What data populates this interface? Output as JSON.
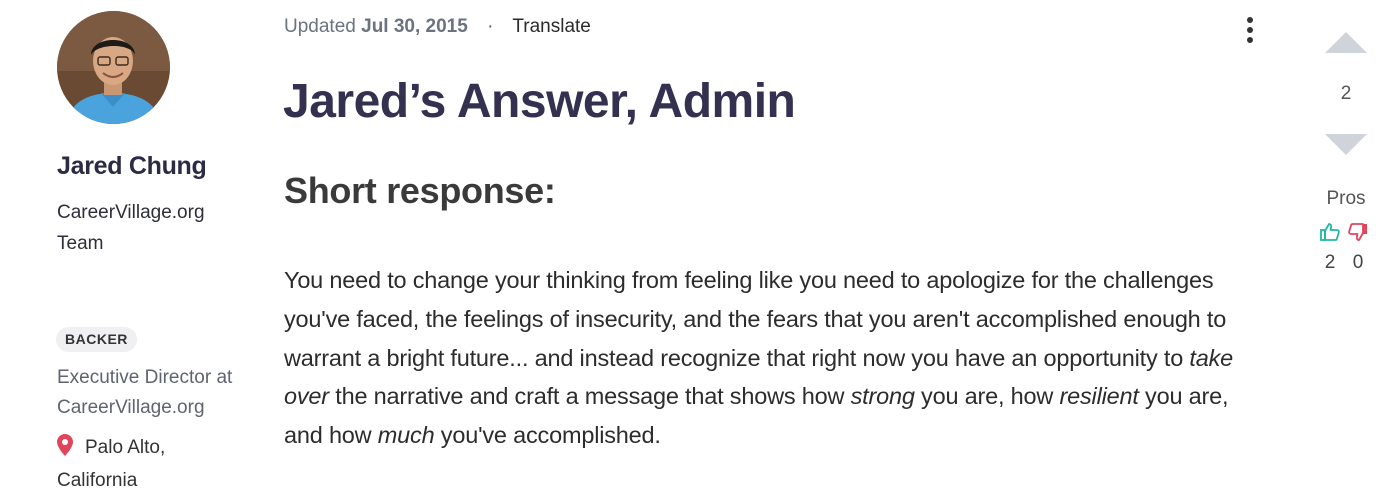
{
  "author": {
    "name": "Jared Chung",
    "org": "CareerVillage.org Team",
    "badge": "BACKER",
    "title": "Executive Director at CareerVillage.org",
    "location": "Palo Alto,\nCalifornia",
    "avatar_icon": "person-avatar"
  },
  "meta": {
    "updated_label": "Updated",
    "updated_date": "Jul 30, 2015",
    "separator": "·",
    "translate_label": "Translate"
  },
  "answer": {
    "title": "Jared’s Answer, Admin",
    "subheading": "Short response:",
    "body": [
      {
        "text": "You need to change your thinking from feeling like you need to apologize for the challenges you've faced, the feelings of insecurity, and the fears that you aren't accomplished enough to warrant a bright future... and instead recognize that right now you have an opportunity to ",
        "italic": false
      },
      {
        "text": "take over",
        "italic": true
      },
      {
        "text": " the narrative and craft a message that shows how ",
        "italic": false
      },
      {
        "text": "strong",
        "italic": true
      },
      {
        "text": " you are, how ",
        "italic": false
      },
      {
        "text": "resilient",
        "italic": true
      },
      {
        "text": " you are, and how ",
        "italic": false
      },
      {
        "text": "much",
        "italic": true
      },
      {
        "text": " you've accomplished.",
        "italic": false
      }
    ]
  },
  "votes": {
    "count": "2",
    "up_icon": "triangle-up-icon",
    "down_icon": "triangle-down-icon"
  },
  "pros": {
    "label": "Pros",
    "pro_count": "2",
    "con_count": "0"
  },
  "colors": {
    "title": "#34304f",
    "pin": "#e0455c",
    "thumb_up": "#22b8a3",
    "thumb_down": "#e0455c",
    "vote_arrow": "#cfd4da"
  }
}
